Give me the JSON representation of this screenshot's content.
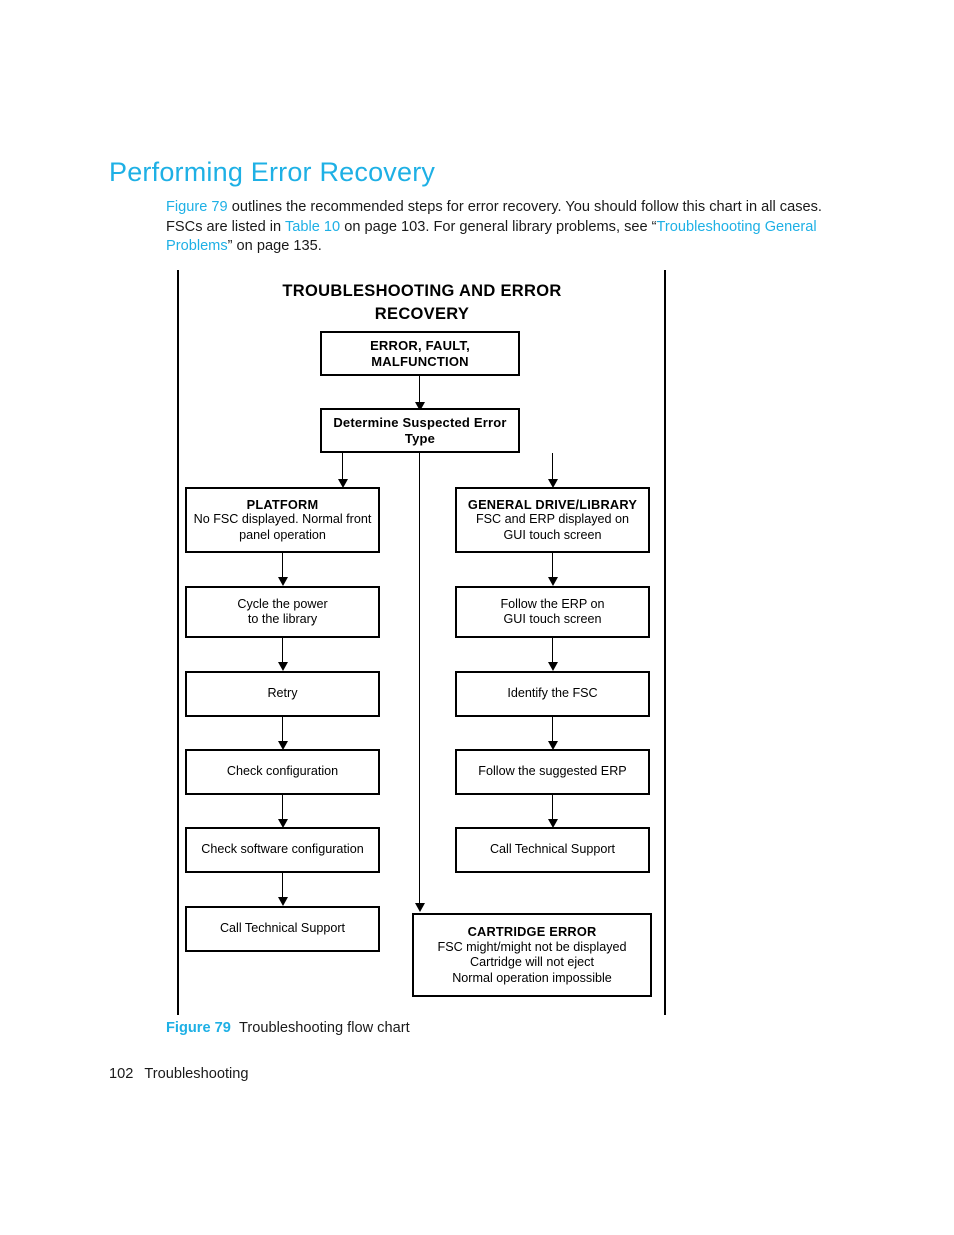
{
  "page": {
    "heading": "Performing Error Recovery",
    "footer_page_number": "102",
    "footer_section": "Troubleshooting"
  },
  "intro": {
    "link_figure": "Figure 79",
    "text_1": " outlines the recommended steps for error recovery. You should follow this chart in all cases. FSCs are listed in ",
    "link_table": "Table 10",
    "text_2": " on page 103. For general library problems, see “",
    "link_troubleshooting": "Troubleshooting General Problems",
    "text_3": "” on page 135."
  },
  "figure_caption": {
    "number": "Figure 79",
    "title": "Troubleshooting flow chart"
  },
  "chart_data": {
    "type": "diagram",
    "title_line_1": "TROUBLESHOOTING",
    "title_line_2": "AND ERROR RECOVERY",
    "nodes": {
      "start": {
        "label": "ERROR, FAULT, MALFUNCTION"
      },
      "decision": {
        "label": "Determine Suspected Error Type"
      },
      "platform": {
        "header": "PLATFORM",
        "line_1": "No FSC displayed. Normal front",
        "line_2": "panel operation"
      },
      "platform_step_1": {
        "line_1": "Cycle the power",
        "line_2": "to the library"
      },
      "platform_step_2": {
        "line_1": "Retry"
      },
      "platform_step_3": {
        "line_1": "Check configuration"
      },
      "platform_step_4": {
        "line_1": "Check software configuration"
      },
      "platform_step_5": {
        "line_1": "Call Technical Support"
      },
      "general": {
        "header": "GENERAL DRIVE/LIBRARY",
        "line_1": "FSC and ERP displayed on",
        "line_2": "GUI touch screen"
      },
      "general_step_1": {
        "line_1": "Follow the ERP on",
        "line_2": "GUI touch screen"
      },
      "general_step_2": {
        "line_1": "Identify the FSC"
      },
      "general_step_3": {
        "line_1": "Follow the suggested ERP"
      },
      "general_step_4": {
        "line_1": "Call Technical Support"
      },
      "cartridge": {
        "header": "CARTRIDGE ERROR",
        "line_1": "FSC might/might not be displayed",
        "line_2": "Cartridge will not eject",
        "line_3": "Normal operation impossible"
      }
    },
    "branches": [
      "PLATFORM",
      "CARTRIDGE ERROR",
      "GENERAL DRIVE/LIBRARY"
    ],
    "colors": {
      "accent": "#1eb0e5",
      "line": "#000000",
      "text": "#1a1a1a"
    }
  }
}
